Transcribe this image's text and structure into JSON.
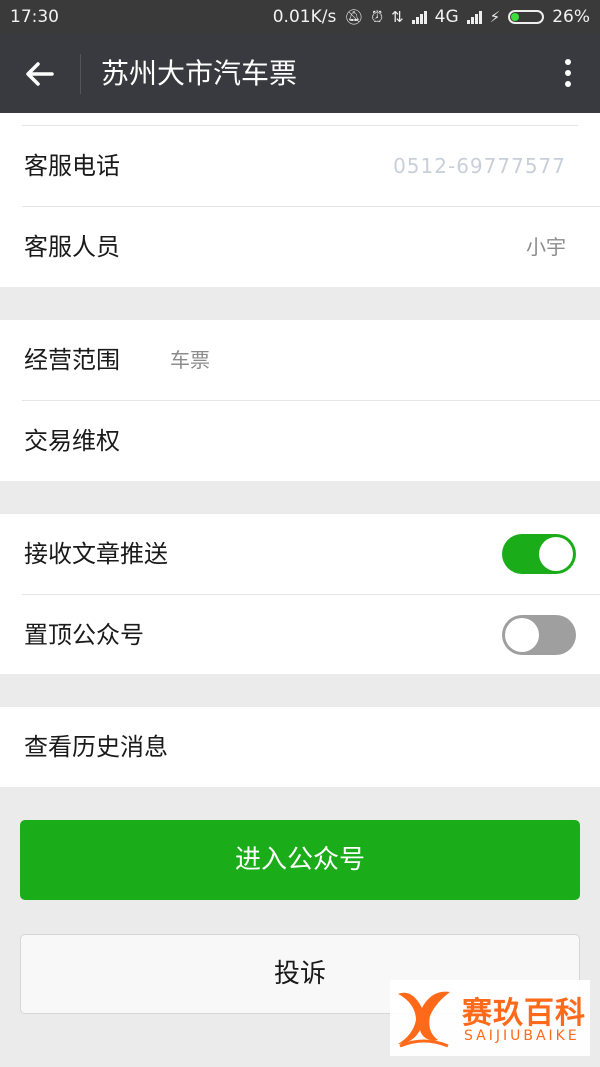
{
  "status_bar": {
    "time": "17:30",
    "network_speed": "0.01K/s",
    "network_type": "4G",
    "battery_percent": "26%",
    "icons": [
      "mute-icon",
      "alarm-icon",
      "data-transfer-icon",
      "signal-icon",
      "signal-icon",
      "charging-icon",
      "battery-icon"
    ]
  },
  "header": {
    "title": "苏州大市汽车票",
    "back_icon": "arrow-left-icon",
    "more_icon": "more-vertical-icon"
  },
  "info_group": {
    "phone_label": "客服电话",
    "phone_value": "0512-69777577",
    "staff_label": "客服人员",
    "staff_value": "小宇"
  },
  "business_group": {
    "scope_label": "经营范围",
    "scope_value": "车票",
    "rights_label": "交易维权"
  },
  "settings_group": {
    "receive_label": "接收文章推送",
    "receive_on": true,
    "pin_label": "置顶公众号",
    "pin_on": false
  },
  "history": {
    "label": "查看历史消息"
  },
  "actions": {
    "enter_label": "进入公众号",
    "complain_label": "投诉"
  },
  "watermark": {
    "cn": "赛玖百科",
    "en": "SAIJIUBAIKE"
  },
  "colors": {
    "accent_green": "#1aad19",
    "titlebar": "#393a3f",
    "watermark_orange": "#ff6a1a"
  }
}
